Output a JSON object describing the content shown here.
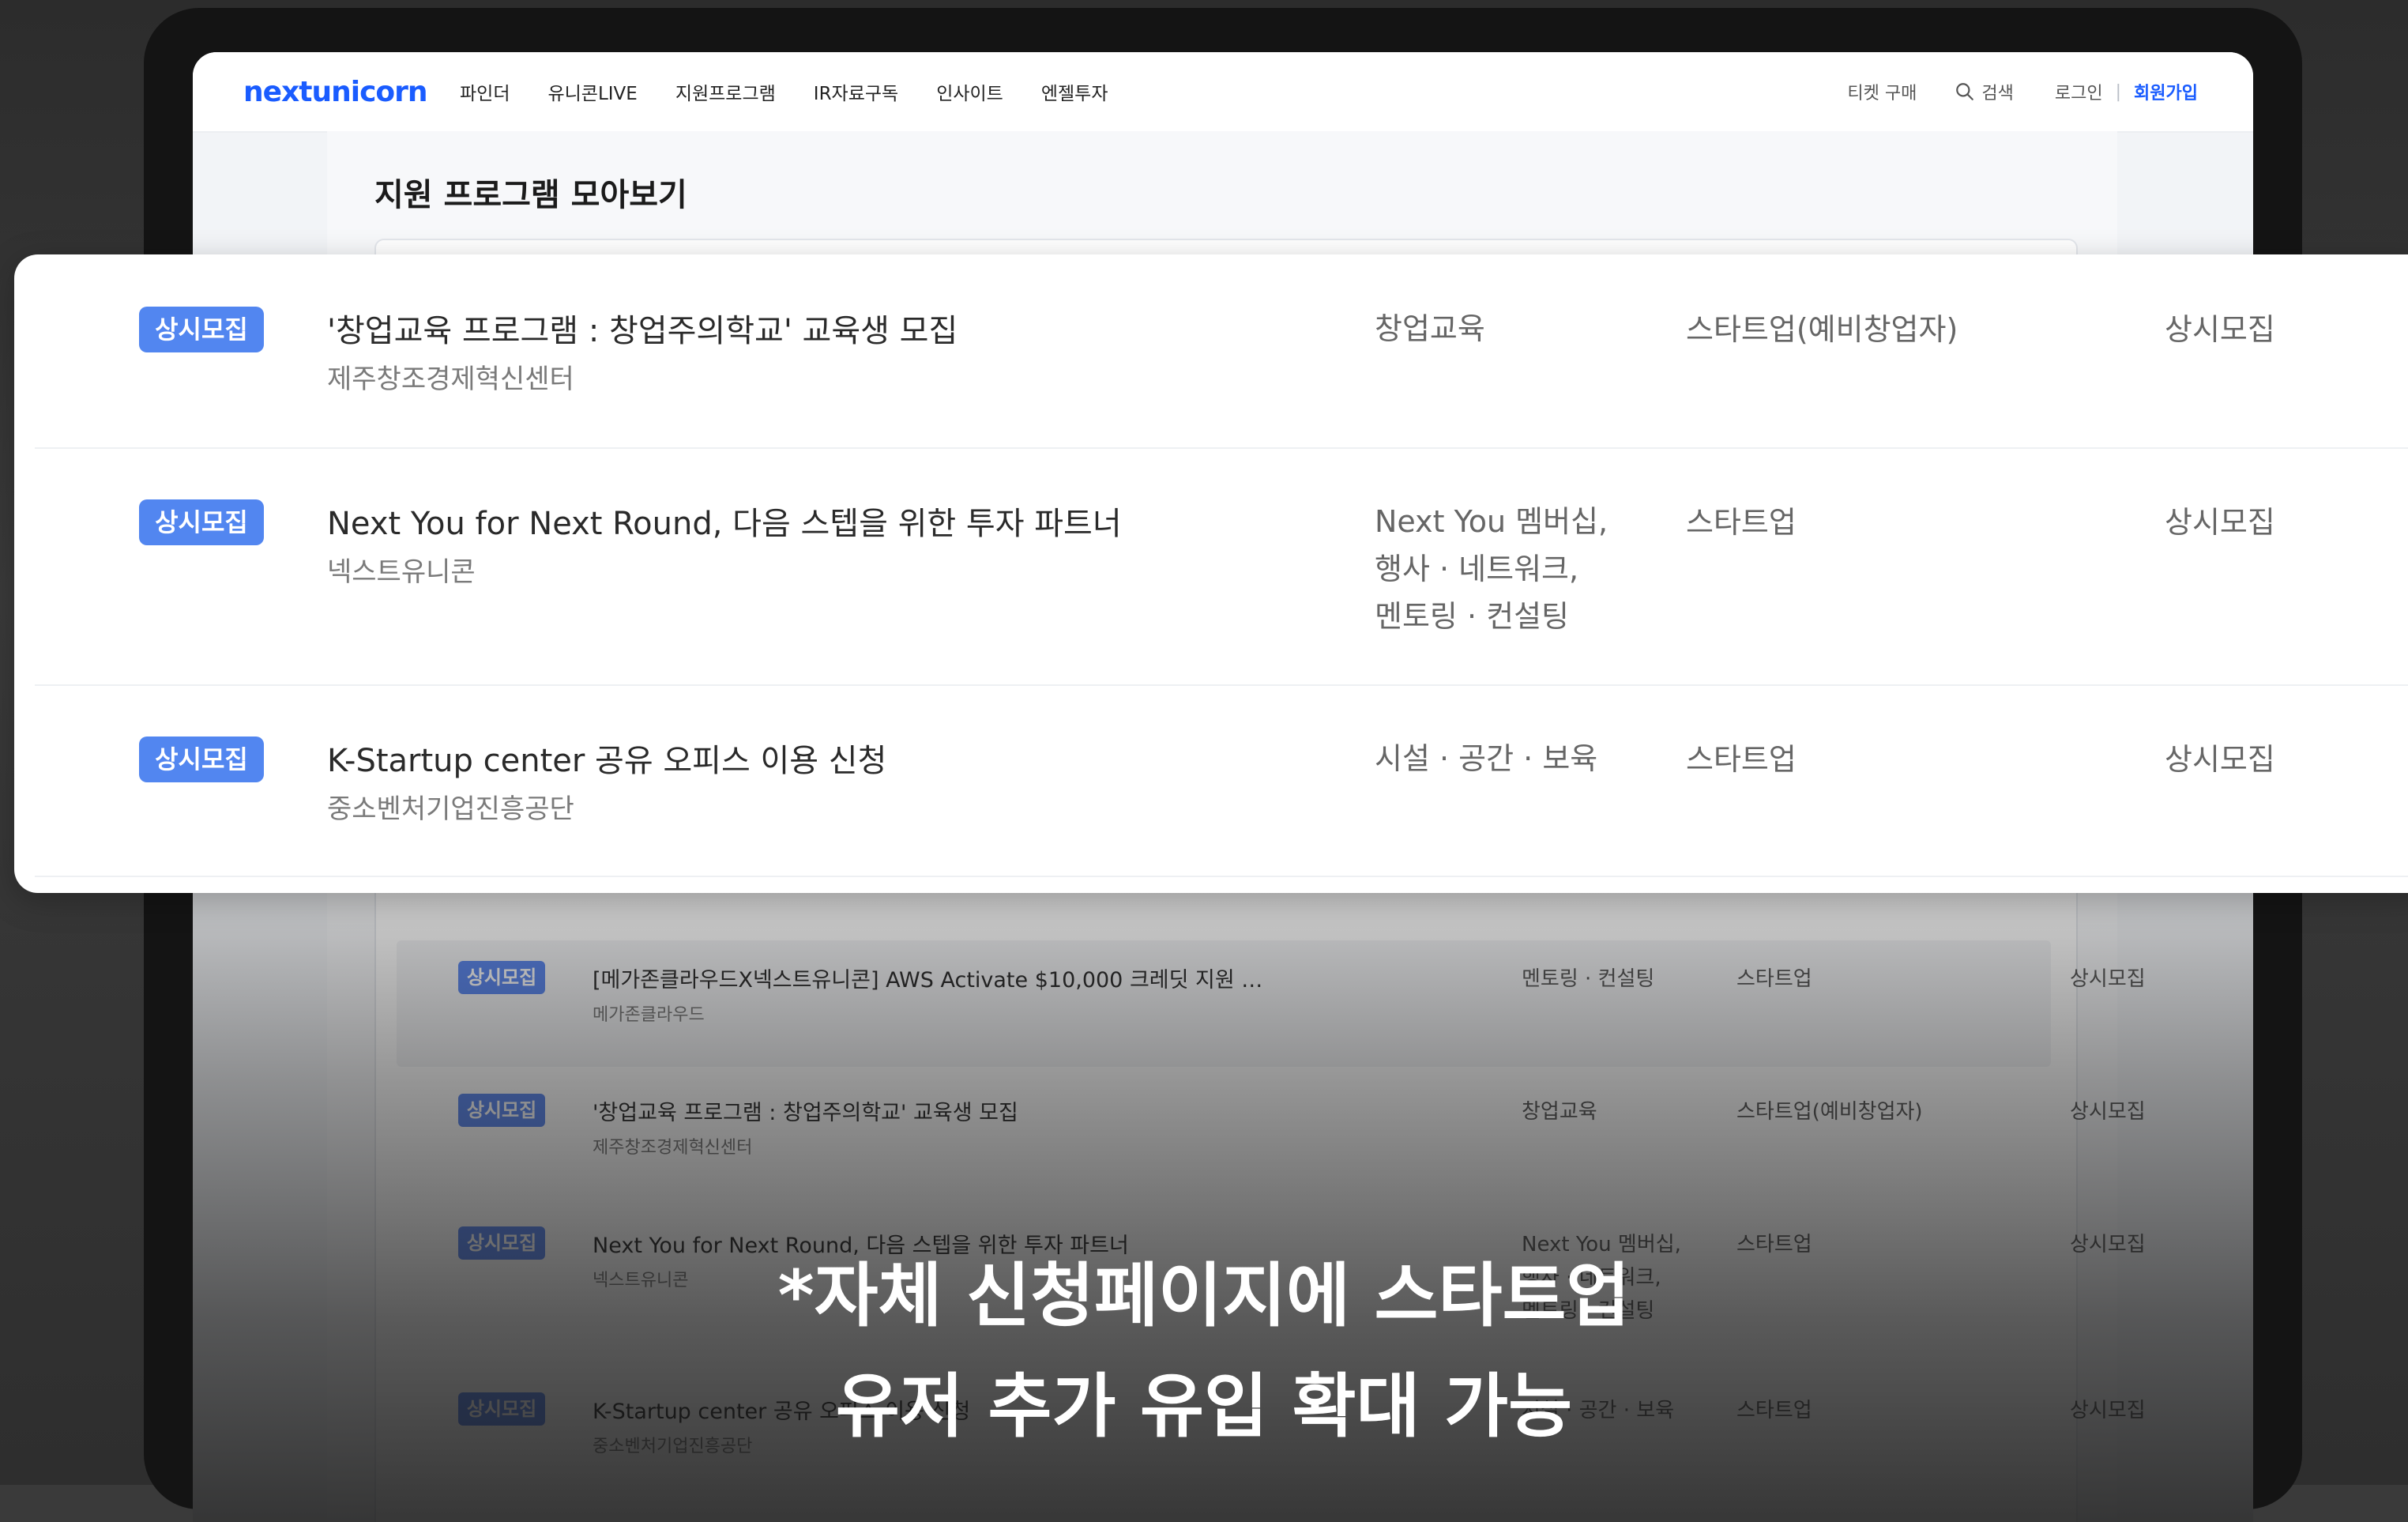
{
  "brand": {
    "name": "nextunicorn",
    "accent": "#1a5cff",
    "badge_color": "#5286f0"
  },
  "nav": {
    "items": [
      "파인더",
      "유니콘LIVE",
      "지원프로그램",
      "IR자료구독",
      "인사이트",
      "엔젤투자"
    ],
    "ticket": "티켓 구매",
    "search": "검색",
    "search_icon": "search-icon",
    "login": "로그인",
    "divider": "|",
    "signup": "회원가입"
  },
  "page": {
    "title": "지원 프로그램 모아보기"
  },
  "background_list": [
    {
      "badge": "상시모집",
      "title": "[메가존클라우드X넥스트유니콘] AWS Activate $10,000 크레딧 지원 …",
      "org": "메가존클라우드",
      "category": "멘토링 · 컨설팅",
      "target": "스타트업",
      "period": "상시모집"
    },
    {
      "badge": "상시모집",
      "title": "'창업교육 프로그램 : 창업주의학교' 교육생 모집",
      "org": "제주창조경제혁신센터",
      "category": "창업교육",
      "target": "스타트업(예비창업자)",
      "period": "상시모집"
    },
    {
      "badge": "상시모집",
      "title": "Next You for Next Round, 다음 스텝을 위한 투자 파트너",
      "org": "넥스트유니콘",
      "category": "Next You 멤버십,\n행사 · 네트워크,\n멘토링 · 컨설팅",
      "target": "스타트업",
      "period": "상시모집"
    },
    {
      "badge": "상시모집",
      "title": "K-Startup center 공유 오피스 이용 신청",
      "org": "중소벤처기업진흥공단",
      "category": "시설 · 공간 · 보육",
      "target": "스타트업",
      "period": "상시모집"
    }
  ],
  "featured": [
    {
      "badge": "상시모집",
      "title": "'창업교육 프로그램 : 창업주의학교' 교육생 모집",
      "org": "제주창조경제혁신센터",
      "category": "창업교육",
      "target": "스타트업(예비창업자)",
      "period": "상시모집"
    },
    {
      "badge": "상시모집",
      "title": "Next You for Next Round, 다음 스텝을 위한 투자 파트너",
      "org": "넥스트유니콘",
      "category": "Next You 멤버십,\n행사 · 네트워크,\n멘토링 · 컨설팅",
      "target": "스타트업",
      "period": "상시모집"
    },
    {
      "badge": "상시모집",
      "title": "K-Startup center 공유 오피스 이용 신청",
      "org": "중소벤처기업진흥공단",
      "category": "시설 · 공간 · 보육",
      "target": "스타트업",
      "period": "상시모집"
    }
  ],
  "caption": {
    "line1": "*자체 신청페이지에 스타트업",
    "line2": "유저 추가 유입 확대 가능"
  }
}
